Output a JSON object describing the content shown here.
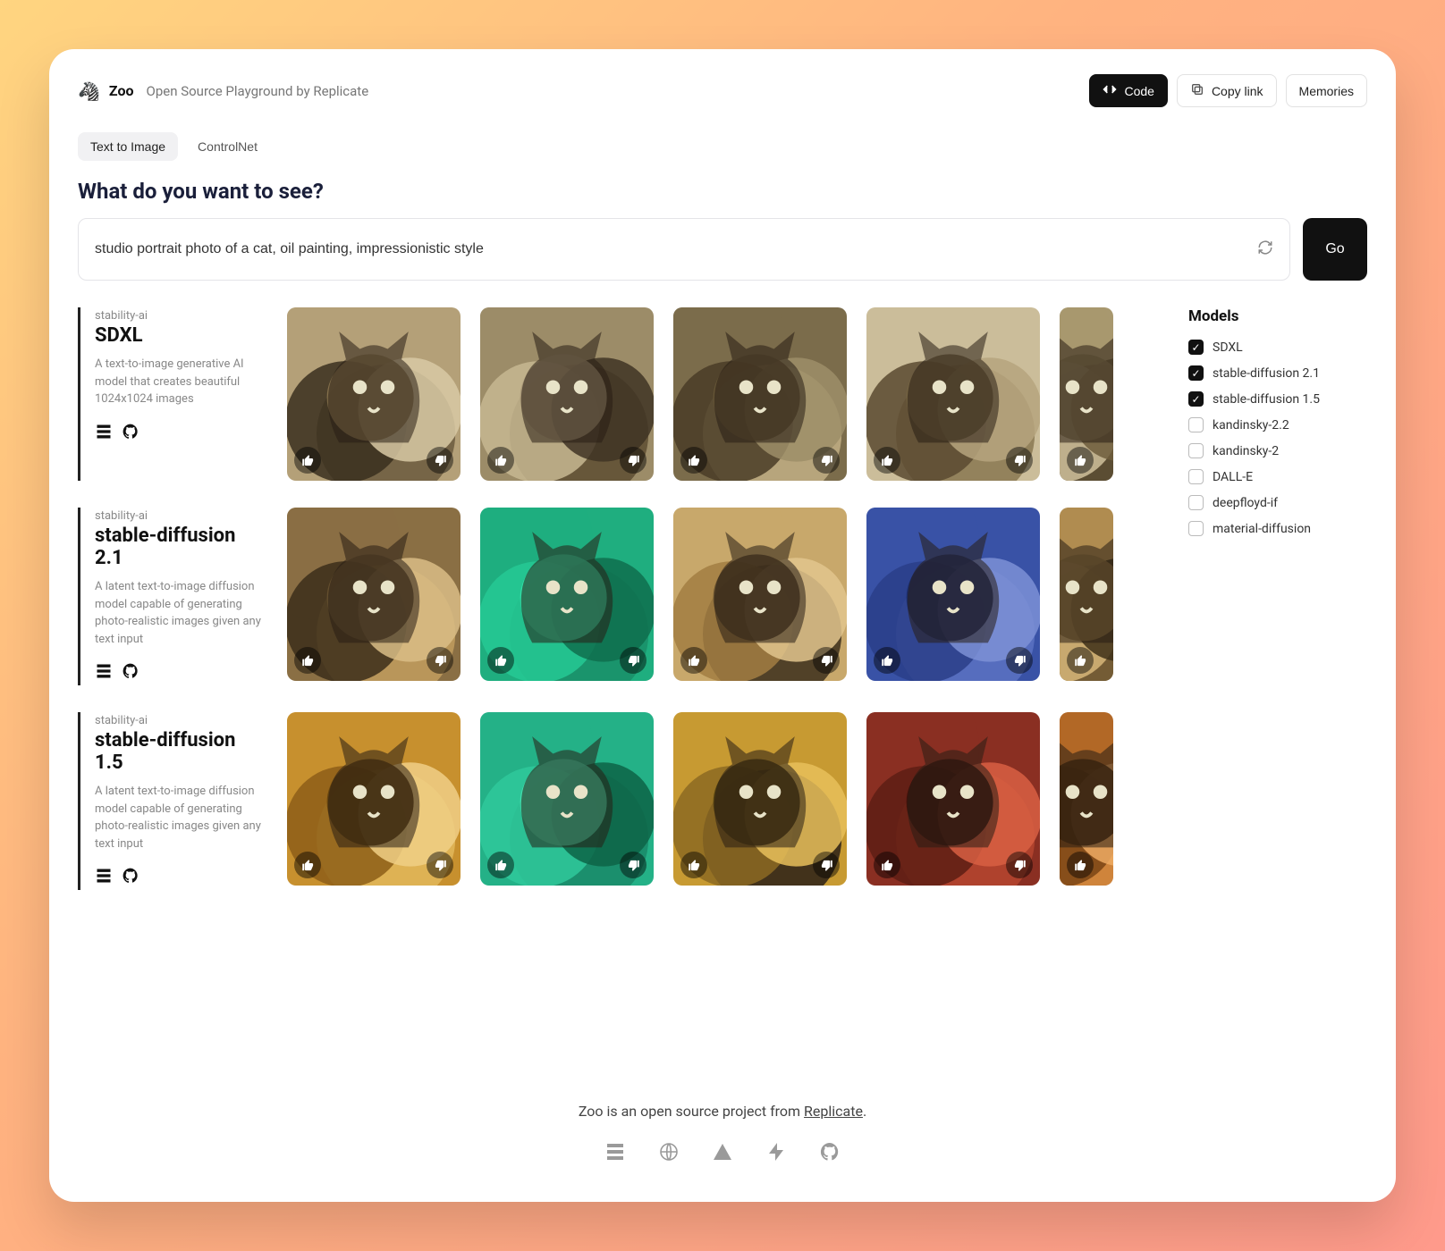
{
  "header": {
    "logo_emoji": "🦓",
    "title": "Zoo",
    "subtitle": "Open Source Playground by Replicate",
    "buttons": {
      "code": "Code",
      "copy_link": "Copy link",
      "memories": "Memories"
    }
  },
  "tabs": [
    {
      "label": "Text to Image",
      "active": true
    },
    {
      "label": "ControlNet",
      "active": false
    }
  ],
  "prompt": {
    "heading": "What do you want to see?",
    "value": "studio portrait photo of a cat, oil painting, impressionistic style",
    "go_label": "Go"
  },
  "models_panel": {
    "title": "Models",
    "options": [
      {
        "name": "SDXL",
        "checked": true
      },
      {
        "name": "stable-diffusion 2.1",
        "checked": true
      },
      {
        "name": "stable-diffusion 1.5",
        "checked": true
      },
      {
        "name": "kandinsky-2.2",
        "checked": false
      },
      {
        "name": "kandinsky-2",
        "checked": false
      },
      {
        "name": "DALL-E",
        "checked": false
      },
      {
        "name": "deepfloyd-if",
        "checked": false
      },
      {
        "name": "material-diffusion",
        "checked": false
      }
    ]
  },
  "results": [
    {
      "vendor": "stability-ai",
      "name": "SDXL",
      "description": "A text-to-image generative AI model that creates beautiful 1024x1024 images",
      "images": 5
    },
    {
      "vendor": "stability-ai",
      "name": "stable-diffusion 2.1",
      "description": "A latent text-to-image diffusion model capable of generating photo-realistic images given any text input",
      "images": 5
    },
    {
      "vendor": "stability-ai",
      "name": "stable-diffusion 1.5",
      "description": "A latent text-to-image diffusion model capable of generating photo-realistic images given any text input",
      "images": 5
    }
  ],
  "footer": {
    "text_prefix": "Zoo is an open source project from ",
    "link_text": "Replicate",
    "text_suffix": "."
  },
  "palettes": [
    [
      [
        "#b4a078",
        "#6b5a3e",
        "#3a2f1f",
        "#d8c9a5",
        "#8f7a52"
      ],
      [
        "#9c8c68",
        "#5e4d33",
        "#c7b792",
        "#3f3424",
        "#a59474"
      ],
      [
        "#7b6c4b",
        "#c2af85",
        "#4a3c27",
        "#9e8e69",
        "#6a5939"
      ],
      [
        "#cbbd9a",
        "#8a7851",
        "#5a4a30",
        "#b6a57e",
        "#766543"
      ],
      [
        "#a8986f",
        "#4e3f29",
        "#d0c19c",
        "#6e5d3c",
        "#8f7f57"
      ]
    ],
    [
      [
        "#8a6f44",
        "#c19d5e",
        "#3b2e1a",
        "#d9bd86",
        "#6a5431"
      ],
      [
        "#1fae7f",
        "#1a8f68",
        "#26c994",
        "#0f6e4e",
        "#34e2a9"
      ],
      [
        "#c8a86b",
        "#3c2f1c",
        "#a27e42",
        "#e2c58d",
        "#5b4629"
      ],
      [
        "#3952a6",
        "#5c72c2",
        "#2a3e88",
        "#7d90d6",
        "#1b2b66"
      ],
      [
        "#b08c50",
        "#6a5330",
        "#d7b679",
        "#3e3019",
        "#927442"
      ]
    ],
    [
      [
        "#c7902e",
        "#e2b85a",
        "#8d5e18",
        "#f0cf86",
        "#5e3e0d"
      ],
      [
        "#24b187",
        "#1a8a68",
        "#2fc99b",
        "#0d6447",
        "#45e2b0"
      ],
      [
        "#c79a32",
        "#2a2017",
        "#8c6a22",
        "#e7c05a",
        "#4a390e"
      ],
      [
        "#8a2f22",
        "#b5452f",
        "#5d1d14",
        "#d85f43",
        "#36110b"
      ],
      [
        "#b26827",
        "#d38a3f",
        "#7a4415",
        "#efab64",
        "#4a2a0c"
      ]
    ]
  ]
}
